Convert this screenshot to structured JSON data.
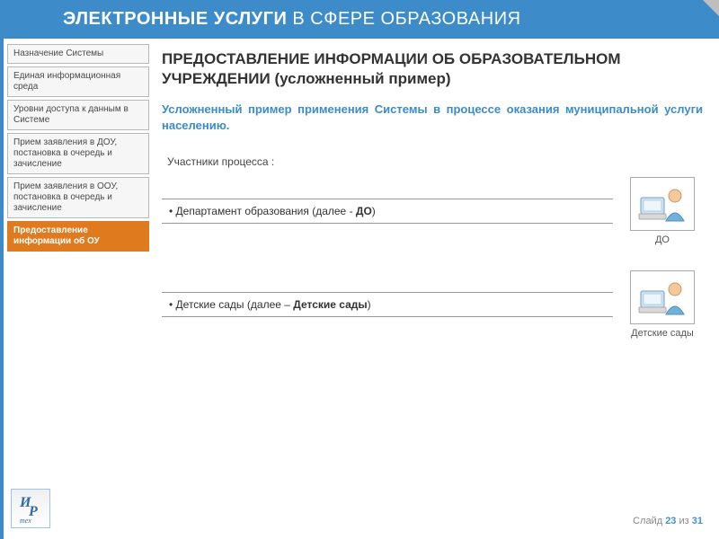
{
  "header": {
    "bold": "ЭЛЕКТРОННЫЕ УСЛУГИ",
    "thin": " В СФЕРЕ ОБРАЗОВАНИЯ"
  },
  "sidebar": {
    "items": [
      {
        "label": "Назначение Системы",
        "active": false
      },
      {
        "label": "Единая информационная среда",
        "active": false
      },
      {
        "label": "Уровни доступа к данным в Системе",
        "active": false
      },
      {
        "label": "Прием заявления в ДОУ, постановка в очередь и зачисление",
        "active": false
      },
      {
        "label": "Прием заявления в ООУ, постановка в очередь и зачисление",
        "active": false
      },
      {
        "label": "Предоставление информации об ОУ",
        "active": true
      }
    ]
  },
  "main": {
    "title": "ПРЕДОСТАВЛЕНИЕ ИНФОРМАЦИИ ОБ ОБРАЗОВАТЕЛЬНОМ УЧРЕЖДЕНИИ (усложненный пример)",
    "subtitle": "Усложненный пример применения Системы в процессе оказания муниципальной услуги населению.",
    "participants_heading": "Участники процесса :",
    "p1_prefix": "• Департамент образования (далее - ",
    "p1_bold": "ДО",
    "p1_suffix": ")",
    "p1_label": "ДО",
    "p2_prefix": "• Детские сады (далее – ",
    "p2_bold": "Детские сады",
    "p2_suffix": ")",
    "p2_label": "Детские сады"
  },
  "logo": {
    "line1": "И",
    "line2": "Р",
    "sub": "тех"
  },
  "footer": {
    "prefix": "Слайд ",
    "current": "23",
    "mid": " из ",
    "total": "31"
  }
}
